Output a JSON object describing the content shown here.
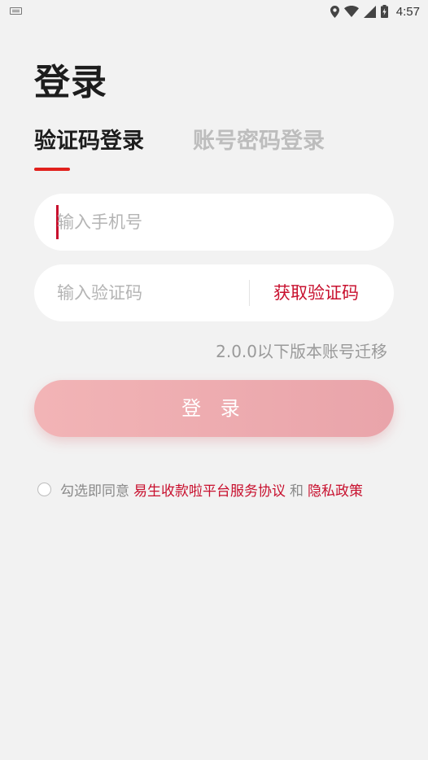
{
  "status_bar": {
    "time": "4:57",
    "icons": [
      "keyboard-icon",
      "location-icon",
      "wifi-icon",
      "signal-icon",
      "battery-charging-icon"
    ]
  },
  "page": {
    "title": "登录"
  },
  "tabs": {
    "active_label": "验证码登录",
    "inactive_label": "账号密码登录"
  },
  "phone_input": {
    "placeholder": "输入手机号",
    "value": ""
  },
  "code_input": {
    "placeholder": "输入验证码",
    "value": "",
    "get_code_label": "获取验证码"
  },
  "migrate_link": "2.0.0以下版本账号迁移",
  "login_button": "登 录",
  "agreement": {
    "prefix": "勾选即同意",
    "service_link": "易生收款啦平台服务协议",
    "and": "和",
    "privacy_link": "隐私政策",
    "checked": false
  },
  "colors": {
    "background": "#f2f2f2",
    "accent": "#c8102e",
    "tab_indicator": "#e1201c",
    "login_button": "#efb0b4"
  }
}
